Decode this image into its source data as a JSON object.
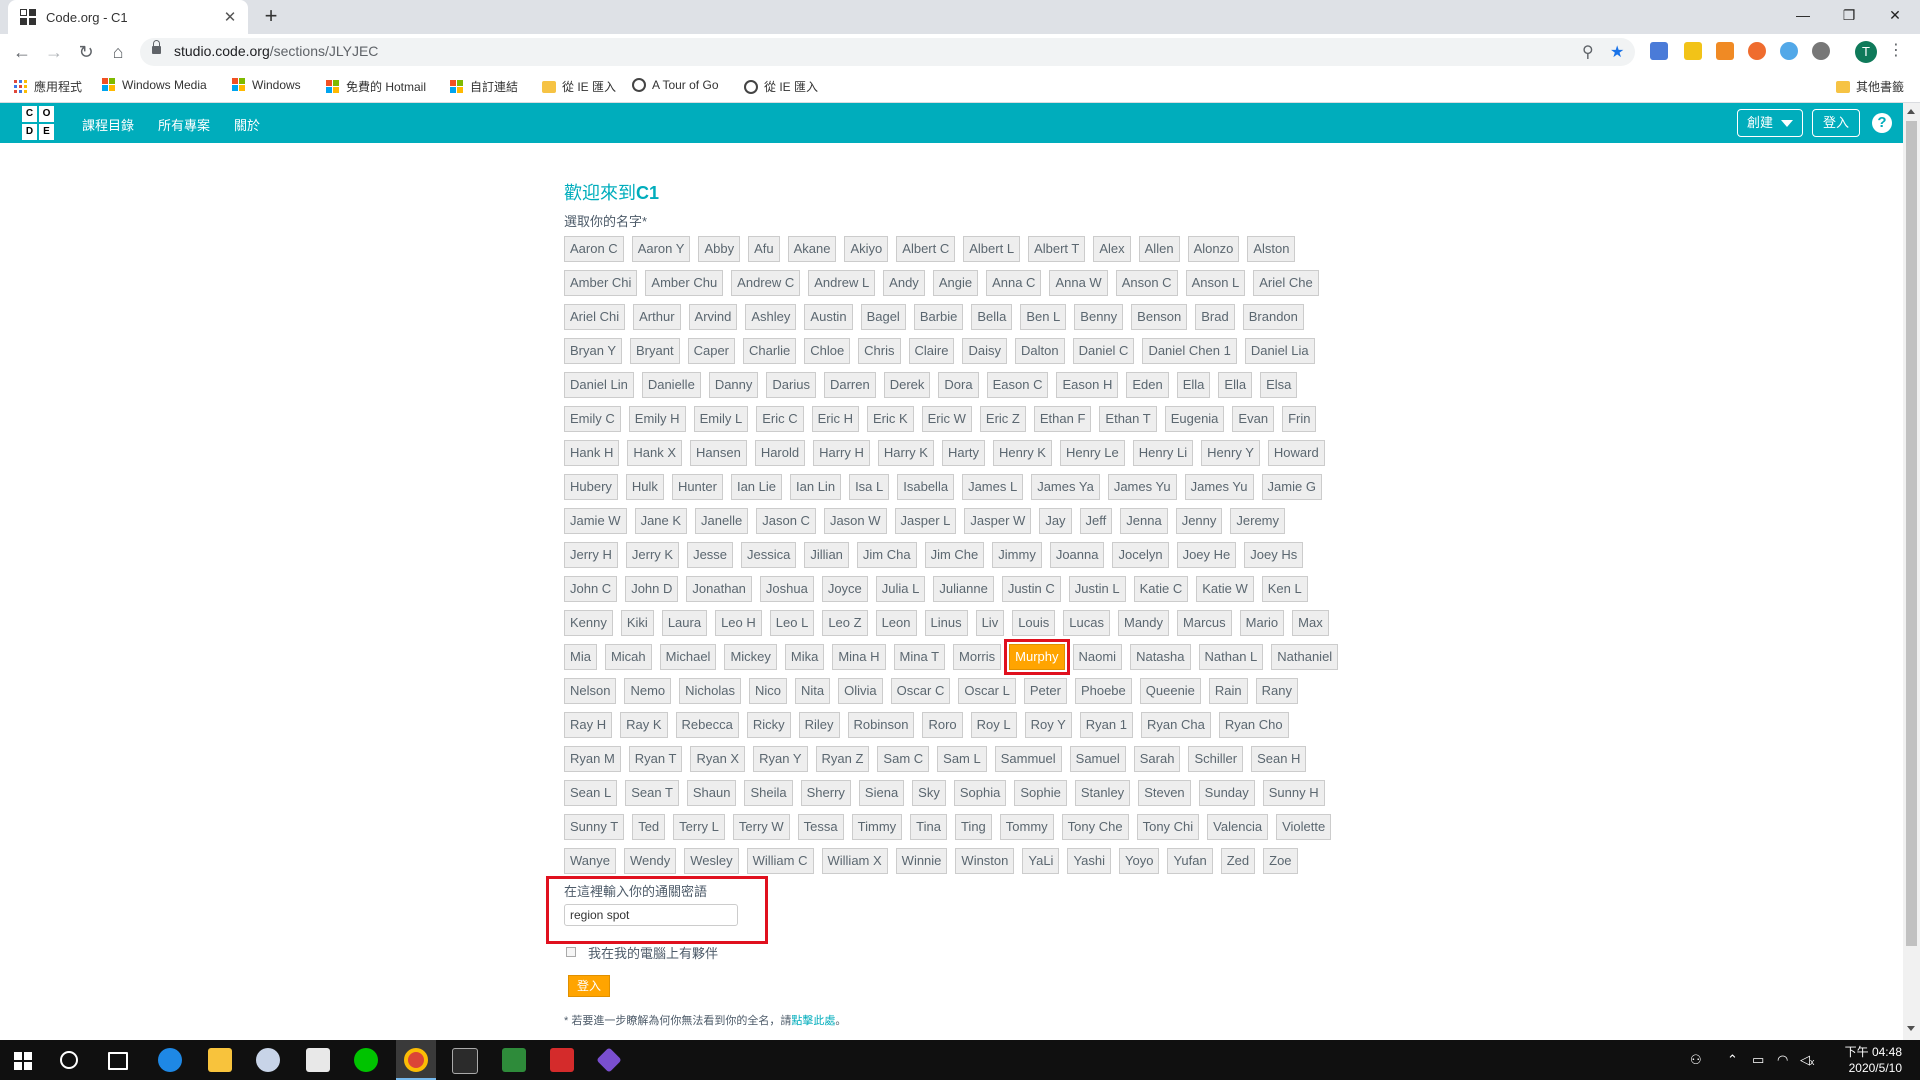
{
  "browser": {
    "tab_title": "Code.org - C1",
    "tab_close": "✕",
    "new_tab": "+",
    "window": {
      "minimize": "—",
      "maximize": "❐",
      "close": "✕"
    },
    "url_domain": "studio.code.org",
    "url_path": "/sections/JLYJEC",
    "bookmarks": [
      "應用程式",
      "Windows Media",
      "Windows",
      "免費的 Hotmail",
      "自訂連結",
      "從 IE 匯入",
      "A Tour of Go",
      "從 IE 匯入"
    ],
    "other_bookmarks": "其他書籤",
    "profile_initial": "T"
  },
  "header": {
    "logo": [
      "C",
      "O",
      "D",
      "E"
    ],
    "nav": [
      "課程目錄",
      "所有專案",
      "關於"
    ],
    "create": "創建",
    "signin": "登入",
    "help": "?"
  },
  "main": {
    "welcome_prefix": "歡迎來到",
    "section_name": "C1",
    "pick_label": "選取你的名字*",
    "names": [
      "Aaron C",
      "Aaron Y",
      "Abby",
      "Afu",
      "Akane",
      "Akiyo",
      "Albert C",
      "Albert L",
      "Albert T",
      "Alex",
      "Allen",
      "Alonzo",
      "Alston",
      "Amber Chi",
      "Amber Chu",
      "Andrew C",
      "Andrew L",
      "Andy",
      "Angie",
      "Anna C",
      "Anna W",
      "Anson C",
      "Anson L",
      "Ariel Che",
      "Ariel Chi",
      "Arthur",
      "Arvind",
      "Ashley",
      "Austin",
      "Bagel",
      "Barbie",
      "Bella",
      "Ben L",
      "Benny",
      "Benson",
      "Brad",
      "Brandon",
      "Bryan Y",
      "Bryant",
      "Caper",
      "Charlie",
      "Chloe",
      "Chris",
      "Claire",
      "Daisy",
      "Dalton",
      "Daniel C",
      "Daniel Chen 1",
      "Daniel Lia",
      "Daniel Lin",
      "Danielle",
      "Danny",
      "Darius",
      "Darren",
      "Derek",
      "Dora",
      "Eason C",
      "Eason H",
      "Eden",
      "Ella",
      "Ella",
      "Elsa",
      "Emily C",
      "Emily H",
      "Emily L",
      "Eric C",
      "Eric H",
      "Eric K",
      "Eric W",
      "Eric Z",
      "Ethan F",
      "Ethan T",
      "Eugenia",
      "Evan",
      "Frin",
      "Hank H",
      "Hank X",
      "Hansen",
      "Harold",
      "Harry H",
      "Harry K",
      "Harty",
      "Henry K",
      "Henry Le",
      "Henry Li",
      "Henry Y",
      "Howard",
      "Hubery",
      "Hulk",
      "Hunter",
      "Ian Lie",
      "Ian Lin",
      "Isa L",
      "Isabella",
      "James L",
      "James Ya",
      "James Yu",
      "James Yu",
      "Jamie G",
      "Jamie W",
      "Jane K",
      "Janelle",
      "Jason C",
      "Jason W",
      "Jasper L",
      "Jasper W",
      "Jay",
      "Jeff",
      "Jenna",
      "Jenny",
      "Jeremy",
      "Jerry H",
      "Jerry K",
      "Jesse",
      "Jessica",
      "Jillian",
      "Jim Cha",
      "Jim Che",
      "Jimmy",
      "Joanna",
      "Jocelyn",
      "Joey He",
      "Joey Hs",
      "John C",
      "John D",
      "Jonathan",
      "Joshua",
      "Joyce",
      "Julia L",
      "Julianne",
      "Justin C",
      "Justin L",
      "Katie C",
      "Katie W",
      "Ken L",
      "Kenny",
      "Kiki",
      "Laura",
      "Leo H",
      "Leo L",
      "Leo Z",
      "Leon",
      "Linus",
      "Liv",
      "Louis",
      "Lucas",
      "Mandy",
      "Marcus",
      "Mario",
      "Max",
      "Mia",
      "Micah",
      "Michael",
      "Mickey",
      "Mika",
      "Mina H",
      "Mina T",
      "Morris",
      "Murphy",
      "Naomi",
      "Natasha",
      "Nathan L",
      "Nathaniel",
      "Nelson",
      "Nemo",
      "Nicholas",
      "Nico",
      "Nita",
      "Olivia",
      "Oscar C",
      "Oscar L",
      "Peter",
      "Phoebe",
      "Queenie",
      "Rain",
      "Rany",
      "Ray H",
      "Ray K",
      "Rebecca",
      "Ricky",
      "Riley",
      "Robinson",
      "Roro",
      "Roy L",
      "Roy Y",
      "Ryan 1",
      "Ryan Cha",
      "Ryan Cho",
      "Ryan M",
      "Ryan T",
      "Ryan X",
      "Ryan Y",
      "Ryan Z",
      "Sam C",
      "Sam L",
      "Sammuel",
      "Samuel",
      "Sarah",
      "Schiller",
      "Sean H",
      "Sean L",
      "Sean T",
      "Shaun",
      "Sheila",
      "Sherry",
      "Siena",
      "Sky",
      "Sophia",
      "Sophie",
      "Stanley",
      "Steven",
      "Sunday",
      "Sunny H",
      "Sunny T",
      "Ted",
      "Terry L",
      "Terry W",
      "Tessa",
      "Timmy",
      "Tina",
      "Ting",
      "Tommy",
      "Tony Che",
      "Tony Chi",
      "Valencia",
      "Violette",
      "Wanye",
      "Wendy",
      "Wesley",
      "William C",
      "William X",
      "Winnie",
      "Winston",
      "YaLi",
      "Yashi",
      "Yoyo",
      "Yufan",
      "Zed",
      "Zoe"
    ],
    "selected_name": "Murphy",
    "secret_label": "在這裡輸入你的通關密語",
    "secret_value": "region spot",
    "partner_label": "我在我的電腦上有夥伴",
    "login_button": "登入",
    "footnote_text": "* 若要進一步瞭解為何你無法看到你的全名，請",
    "footnote_link": "點擊此處",
    "footnote_end": "。"
  },
  "taskbar": {
    "time": "下午 04:48",
    "date": "2020/5/10"
  },
  "colors": {
    "brand": "#00adbc",
    "selected": "#ffa400",
    "highlight": "#e0101e"
  }
}
